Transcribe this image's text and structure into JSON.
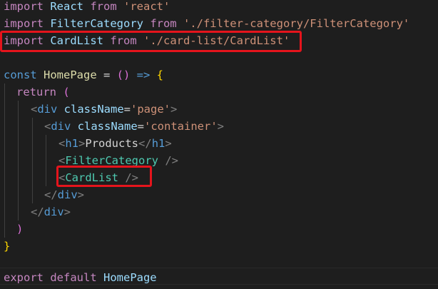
{
  "editor": {
    "language": "javascript-react",
    "colors": {
      "background": "#1e1e1e",
      "keyword_control": "#c586c0",
      "keyword_storage": "#569cd6",
      "variable": "#9cdcfe",
      "string": "#ce9178",
      "component": "#4ec9b0",
      "highlight_box": "#e5141c"
    },
    "lines": [
      {
        "t1": "import",
        "t2": " React ",
        "t3": "from",
        "t4": " 'react'"
      },
      {
        "t1": "import",
        "t2": " FilterCategory ",
        "t3": "from",
        "t4": " './filter-category/FilterCategory'"
      },
      {
        "t1": "import",
        "t2": " CardList ",
        "t3": "from",
        "t4": " './card-list/CardList'"
      },
      {},
      {
        "t1": "const",
        "t2": " HomePage",
        "t3": " = ",
        "t4": "()",
        "t5": " => ",
        "t6": "{"
      },
      {
        "t1": "return",
        "t2": " ("
      },
      {
        "t1": "<",
        "t2": "div",
        "t3": " className",
        "t4": "=",
        "t5": "'page'",
        "t6": ">"
      },
      {
        "t1": "<",
        "t2": "div",
        "t3": " className",
        "t4": "=",
        "t5": "'container'",
        "t6": ">"
      },
      {
        "t1": "<",
        "t2": "h1",
        "t3": ">",
        "t4": "Products",
        "t5": "</",
        "t6": "h1",
        "t7": ">"
      },
      {
        "t1": "<",
        "t2": "FilterCategory",
        "t3": " />"
      },
      {
        "t1": "<",
        "t2": "CardList",
        "t3": " />"
      },
      {
        "t1": "</",
        "t2": "div",
        "t3": ">"
      },
      {
        "t1": "</",
        "t2": "div",
        "t3": ">"
      },
      {
        "t1": ")"
      },
      {
        "t1": "}"
      },
      {},
      {
        "t1": "export",
        "t2": " default",
        "t3": " HomePage"
      }
    ],
    "annotations": [
      {
        "label": "import CardList highlight"
      },
      {
        "label": "CardList usage highlight"
      }
    ]
  }
}
